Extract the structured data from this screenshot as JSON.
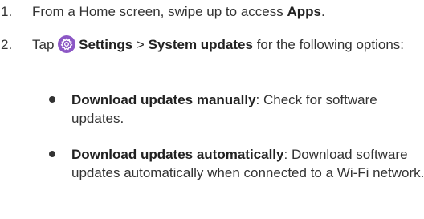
{
  "colors": {
    "settings_icon_bg": "#8c57c5",
    "text": "#333333"
  },
  "steps": [
    {
      "number": "1.",
      "text_before": "From a Home screen, swipe up to access ",
      "bold": "Apps",
      "text_after": "."
    },
    {
      "number": "2.",
      "text_tap": "Tap ",
      "icon": "settings-gear-icon",
      "bold_settings": "Settings",
      "separator": " > ",
      "bold_system_updates": "System updates",
      "text_after": " for the following options:"
    }
  ],
  "options": [
    {
      "bold": "Download updates manually",
      "text": ": Check for software updates."
    },
    {
      "bold": "Download updates automatically",
      "text": ": Download software updates automatically when connected to a Wi-Fi network."
    }
  ]
}
